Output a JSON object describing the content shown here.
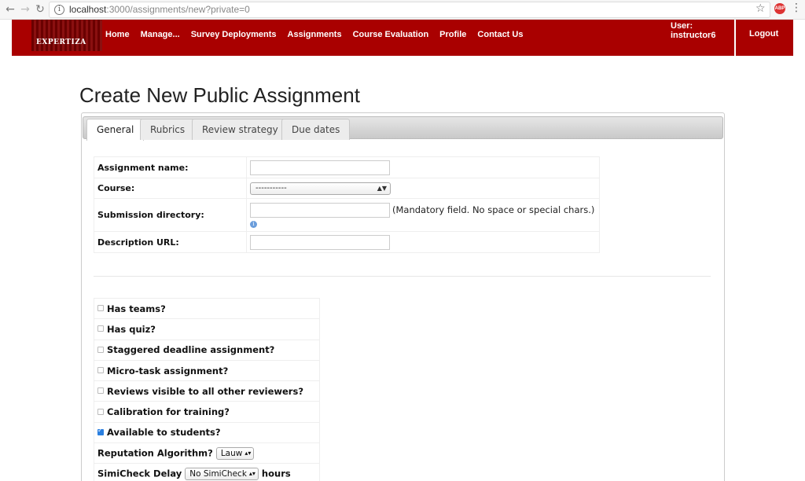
{
  "browser": {
    "url_host": "localhost",
    "url_path": ":3000/assignments/new?private=0",
    "back_icon": "arrow-left-icon",
    "forward_icon": "arrow-right-icon",
    "reload_icon": "reload-icon",
    "abp_badge": "ABP"
  },
  "navbar": {
    "logo_text": "EXPERTIZA",
    "links": [
      "Home",
      "Manage...",
      "Survey Deployments",
      "Assignments",
      "Course Evaluation",
      "Profile",
      "Contact Us"
    ],
    "user_label": "User: instructor6",
    "logout_label": "Logout",
    "bg_color": "#a90000"
  },
  "page": {
    "title": "Create New Public Assignment"
  },
  "tabs": [
    {
      "label": "General",
      "active": true
    },
    {
      "label": "Rubrics",
      "active": false
    },
    {
      "label": "Review strategy",
      "active": false
    },
    {
      "label": "Due dates",
      "active": false
    }
  ],
  "form": {
    "assignment_name_label": "Assignment name:",
    "assignment_name_value": "",
    "course_label": "Course:",
    "course_selected": "-----------",
    "submission_dir_label": "Submission directory:",
    "submission_dir_value": "",
    "submission_dir_hint": "(Mandatory field. No space or special chars.)",
    "description_url_label": "Description URL:",
    "description_url_value": ""
  },
  "options": {
    "has_teams": {
      "label": "Has teams?",
      "checked": false
    },
    "has_quiz": {
      "label": "Has quiz?",
      "checked": false
    },
    "staggered": {
      "label": "Staggered deadline assignment?",
      "checked": false
    },
    "micro_task": {
      "label": "Micro-task assignment?",
      "checked": false
    },
    "reviews_visible": {
      "label": "Reviews visible to all other reviewers?",
      "checked": false
    },
    "calibration": {
      "label": "Calibration for training?",
      "checked": false
    },
    "available": {
      "label": "Available to students?",
      "checked": true
    },
    "reputation_label": "Reputation Algorithm?",
    "reputation_selected": "Lauw",
    "simicheck_label": "SimiCheck Delay",
    "simicheck_selected": "No SimiCheck",
    "simicheck_unit": "hours"
  }
}
